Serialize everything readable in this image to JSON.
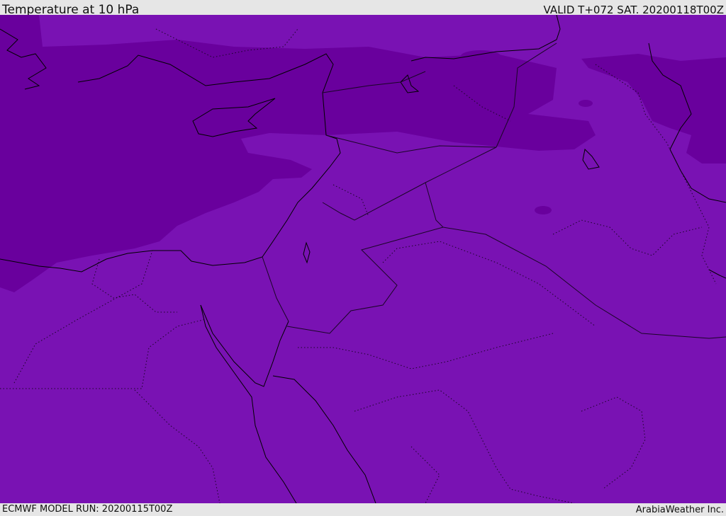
{
  "header": {
    "title": "Temperature at 10 hPa",
    "valid": "VALID T+072 SAT. 20200118T00Z"
  },
  "footer": {
    "model_run": "ECMWF MODEL RUN: 20200115T00Z",
    "credit": "ArabiaWeather Inc."
  },
  "map": {
    "colors": {
      "fill_main": "#7912b3",
      "fill_dark": "#69009d",
      "coastline": "#000000",
      "borders": "#1a0526"
    }
  }
}
